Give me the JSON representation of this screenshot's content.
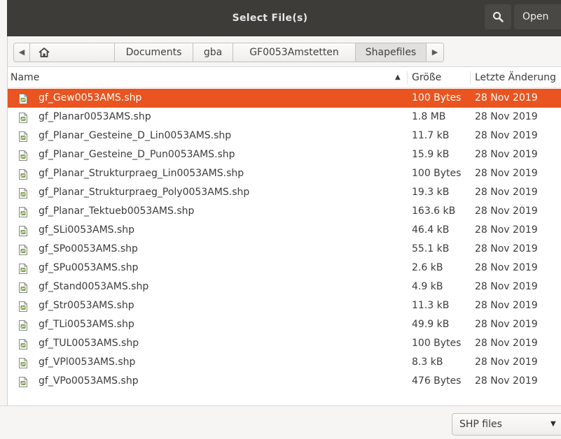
{
  "header": {
    "title": "Select File(s)",
    "open_label": "Open"
  },
  "pathbar": {
    "crumbs": [
      "Documents",
      "gba",
      "GF0053Amstetten",
      "Shapefiles"
    ]
  },
  "columns": {
    "name": "Name",
    "size": "Größe",
    "modified": "Letzte Änderung"
  },
  "files": [
    {
      "name": "gf_Gew0053AMS.shp",
      "size": "100 Bytes",
      "date": "28 Nov 2019"
    },
    {
      "name": "gf_Planar0053AMS.shp",
      "size": "1.8 MB",
      "date": "28 Nov 2019"
    },
    {
      "name": "gf_Planar_Gesteine_D_Lin0053AMS.shp",
      "size": "11.7 kB",
      "date": "28 Nov 2019"
    },
    {
      "name": "gf_Planar_Gesteine_D_Pun0053AMS.shp",
      "size": "15.9 kB",
      "date": "28 Nov 2019"
    },
    {
      "name": "gf_Planar_Strukturpraeg_Lin0053AMS.shp",
      "size": "100 Bytes",
      "date": "28 Nov 2019"
    },
    {
      "name": "gf_Planar_Strukturpraeg_Poly0053AMS.shp",
      "size": "19.3 kB",
      "date": "28 Nov 2019"
    },
    {
      "name": "gf_Planar_Tektueb0053AMS.shp",
      "size": "163.6 kB",
      "date": "28 Nov 2019"
    },
    {
      "name": "gf_SLi0053AMS.shp",
      "size": "46.4 kB",
      "date": "28 Nov 2019"
    },
    {
      "name": "gf_SPo0053AMS.shp",
      "size": "55.1 kB",
      "date": "28 Nov 2019"
    },
    {
      "name": "gf_SPu0053AMS.shp",
      "size": "2.6 kB",
      "date": "28 Nov 2019"
    },
    {
      "name": "gf_Stand0053AMS.shp",
      "size": "4.9 kB",
      "date": "28 Nov 2019"
    },
    {
      "name": "gf_Str0053AMS.shp",
      "size": "11.3 kB",
      "date": "28 Nov 2019"
    },
    {
      "name": "gf_TLi0053AMS.shp",
      "size": "49.9 kB",
      "date": "28 Nov 2019"
    },
    {
      "name": "gf_TUL0053AMS.shp",
      "size": "100 Bytes",
      "date": "28 Nov 2019"
    },
    {
      "name": "gf_VPl0053AMS.shp",
      "size": "8.3 kB",
      "date": "28 Nov 2019"
    },
    {
      "name": "gf_VPo0053AMS.shp",
      "size": "476 Bytes",
      "date": "28 Nov 2019"
    }
  ],
  "selected_index": 0,
  "footer": {
    "filter_label": "SHP files"
  },
  "colors": {
    "headerbar": "#3d3c38",
    "selection": "#e95420"
  },
  "icons": {
    "search": "search-icon",
    "home": "home-icon",
    "file": "file-icon",
    "back": "chevron-left-icon",
    "forward": "chevron-right-icon",
    "sort": "sort-ascending-icon",
    "dropdown": "dropdown-arrow-icon"
  }
}
